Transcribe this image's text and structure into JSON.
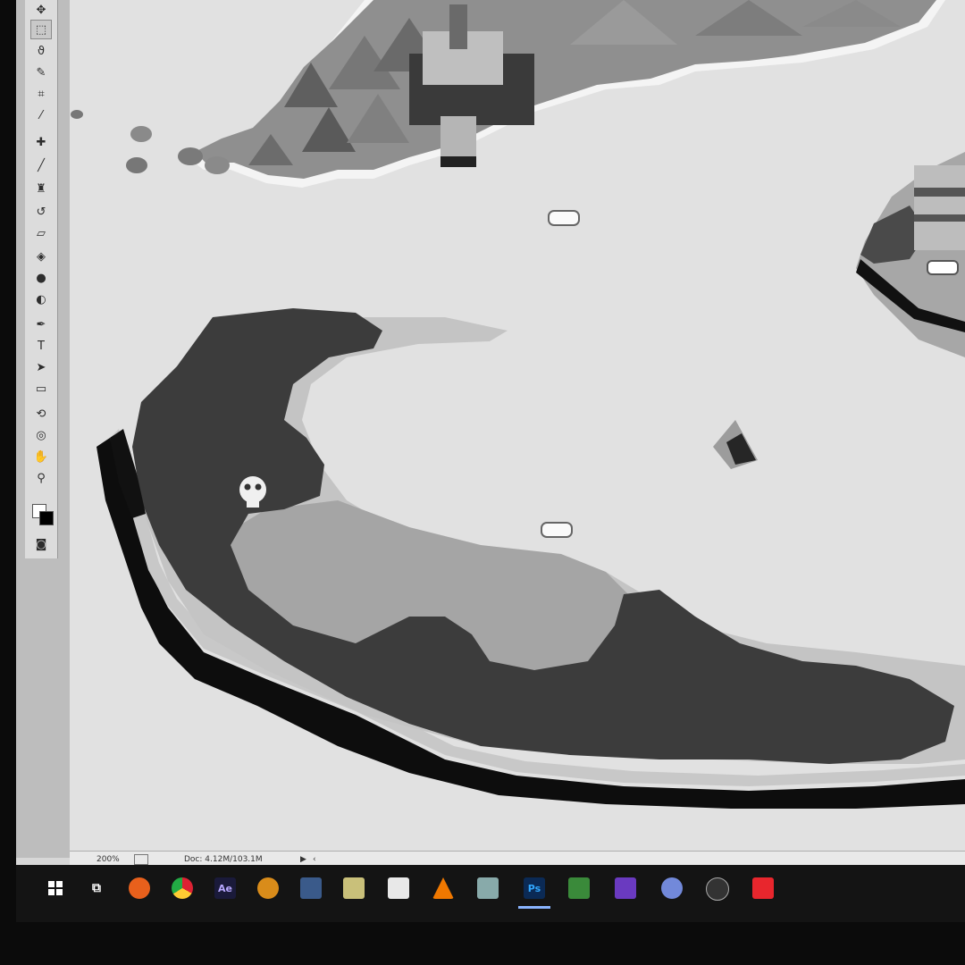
{
  "status": {
    "zoom": "200%",
    "doc_info": "Doc: 4.12M/103.1M"
  },
  "toolbar_tools": [
    "move-tool",
    "marquee-tool",
    "lasso-tool",
    "quick-select-tool",
    "crop-tool",
    "eyedropper-tool",
    "healing-brush-tool",
    "brush-tool",
    "clone-stamp-tool",
    "history-brush-tool",
    "eraser-tool",
    "paint-bucket-tool",
    "blur-tool",
    "dodge-tool",
    "pen-tool",
    "type-tool",
    "path-select-tool",
    "rectangle-tool",
    "3d-rotate-tool",
    "3d-orbit-tool",
    "hand-tool",
    "zoom-tool"
  ],
  "type_tool_glyph": "T",
  "taskbar_apps": [
    {
      "name": "windows-start",
      "label": ""
    },
    {
      "name": "task-view",
      "label": ""
    },
    {
      "name": "firefox",
      "label": ""
    },
    {
      "name": "chrome",
      "label": ""
    },
    {
      "name": "after-effects",
      "label": "Ae"
    },
    {
      "name": "app-burger",
      "label": ""
    },
    {
      "name": "app-media",
      "label": ""
    },
    {
      "name": "app-video",
      "label": ""
    },
    {
      "name": "app-notes",
      "label": ""
    },
    {
      "name": "vlc",
      "label": ""
    },
    {
      "name": "app-scanner",
      "label": ""
    },
    {
      "name": "photoshop",
      "label": "Ps"
    },
    {
      "name": "app-image",
      "label": ""
    },
    {
      "name": "visual-studio",
      "label": ""
    },
    {
      "name": "app-discord",
      "label": ""
    },
    {
      "name": "app-steam",
      "label": ""
    },
    {
      "name": "gamemaker",
      "label": ""
    }
  ],
  "colors": {
    "canvas_bg": "#e1e1e1",
    "island_dark": "#3c3c3c",
    "island_mid": "#a5a5a5",
    "island_light": "#c4c4c4",
    "shadow": "#0d0d0d"
  }
}
